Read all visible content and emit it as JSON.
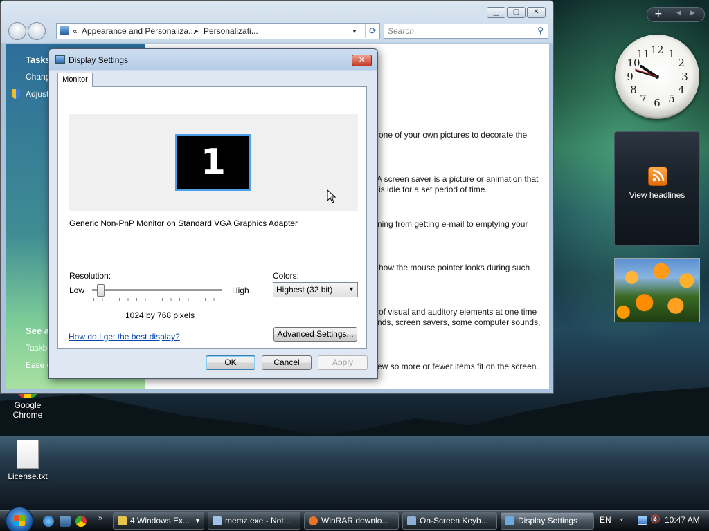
{
  "desktop": {
    "icons": [
      {
        "label": "Google Chrome"
      },
      {
        "label": "License.txt"
      }
    ]
  },
  "sidebar": {
    "clock_numbers": [
      "12",
      "1",
      "2",
      "3",
      "4",
      "5",
      "6",
      "7",
      "8",
      "9",
      "10",
      "11"
    ],
    "feed_label": "View headlines"
  },
  "explorer": {
    "address_root": "«",
    "address_crumb1": "Appearance and Personaliza...",
    "address_sep": "▸",
    "address_crumb2": "Personalizati...",
    "search_placeholder": "Search",
    "left_tasks_title": "Tasks",
    "left_item1": "Chang",
    "left_item2": "Adjust",
    "left_see_also": "See al",
    "left_taskbar": "Taskba",
    "left_ease": "Ease o",
    "main_lines": [
      "one of your own pictures to decorate the",
      "A screen saver is a picture or animation that",
      "is idle for a set period of time.",
      "ning from getting e-mail to emptying your",
      "how the mouse pointer looks during such",
      "of visual and auditory elements at one time",
      "nds, screen savers, some computer sounds,",
      "ew so more or fewer items fit on the screen."
    ]
  },
  "dialog": {
    "title": "Display Settings",
    "close": "✕",
    "tab": "Monitor",
    "monitor_number": "1",
    "adapter_text": "Generic Non-PnP Monitor on Standard VGA Graphics Adapter",
    "resolution_label": "Resolution:",
    "low_label": "Low",
    "high_label": "High",
    "resolution_value": "1024 by 768 pixels",
    "resolution_fraction": 0.05,
    "colors_label": "Colors:",
    "colors_value": "Highest (32 bit)",
    "help_link": "How do I get the best display?",
    "advanced_button": "Advanced Settings...",
    "ok_button": "OK",
    "cancel_button": "Cancel",
    "apply_button": "Apply"
  },
  "taskbar": {
    "tasks": [
      {
        "label": "4 Windows Ex...",
        "icon": "folder-icon",
        "color": "#e8c54a"
      },
      {
        "label": "memz.exe - Not...",
        "icon": "notepad-icon",
        "color": "#9ec3e6"
      },
      {
        "label": "WinRAR downlo...",
        "icon": "firefox-icon",
        "color": "#e8742a"
      },
      {
        "label": "On-Screen Keyb...",
        "icon": "keyboard-icon",
        "color": "#8fb0d8"
      },
      {
        "label": "Display Settings",
        "icon": "display-icon",
        "color": "#6fa8e0"
      }
    ],
    "lang": "EN",
    "clock": "10:47 AM"
  }
}
